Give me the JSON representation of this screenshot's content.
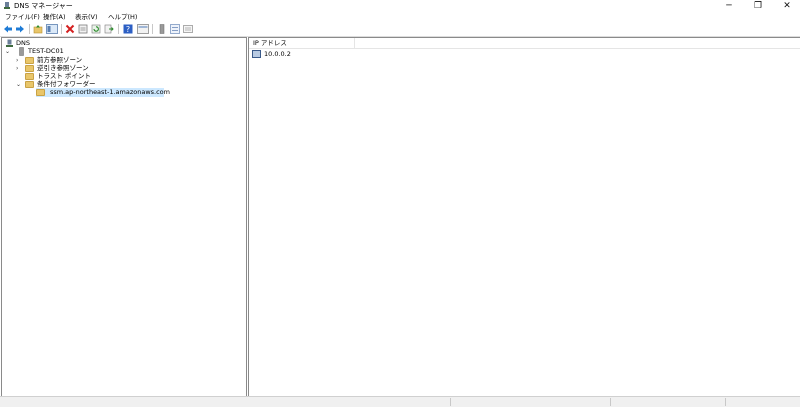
{
  "window": {
    "title": "DNS マネージャー",
    "controls": {
      "minimize": "─",
      "maximize": "❐",
      "close": "✕"
    }
  },
  "menu": [
    {
      "label": "ファイル(F)"
    },
    {
      "label": "操作(A)"
    },
    {
      "label": "表示(V)"
    },
    {
      "label": "ヘルプ(H)"
    }
  ],
  "toolbar": {
    "buttons": [
      "back-icon",
      "forward-icon",
      "up-folder-icon",
      "show-hide-console-tree-icon",
      "delete-icon",
      "properties-icon",
      "refresh-icon",
      "export-list-icon",
      "help-icon",
      "console-icon",
      "server-icon",
      "list-view-icon",
      "detail-view-icon"
    ]
  },
  "tree": {
    "root": "DNS",
    "server": "TEST-DC01",
    "forward_zones": "前方参照ゾーン",
    "reverse_zones": "逆引き参照ゾーン",
    "trust_points": "トラスト ポイント",
    "conditional_forwarders": "条件付フォワーダー",
    "selected_forwarder": "ssm.ap-northeast-1.amazonaws.com"
  },
  "list": {
    "columns": [
      "IP アドレス"
    ],
    "rows": [
      {
        "ip": "10.0.0.2"
      }
    ]
  },
  "colors": {
    "selection": "#cce8ff",
    "folder": "#e9c66a",
    "back_arrow": "#1e7bd6",
    "delete": "#d42020",
    "help": "#2c5fc4"
  }
}
